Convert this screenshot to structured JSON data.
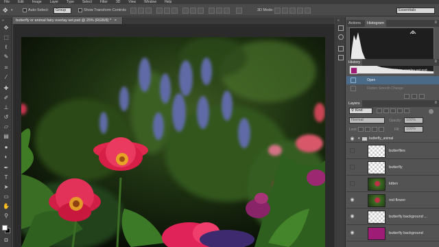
{
  "menu": [
    "File",
    "Edit",
    "Image",
    "Layer",
    "Type",
    "Select",
    "Filter",
    "3D",
    "View",
    "Window",
    "Help"
  ],
  "options": {
    "auto_select_label": "Auto-Select:",
    "auto_select_value": "Group",
    "transform_label": "Show Transform Controls",
    "mode_3d_label": "3D Mode:",
    "workspace": "Essentials"
  },
  "document": {
    "tab_title": "butterfly or animal fairy overlay set.psd @ 25% (RGB/8) *",
    "tab_close": "×"
  },
  "panels": {
    "tabs_top": [
      "Actions",
      "Histogram"
    ],
    "history": {
      "tab": "History",
      "snapshot_label": "butterfly or animal fairy overlay set.psd",
      "items": [
        "Open",
        "Flatten Smooth Change"
      ]
    },
    "layers": {
      "tab": "Layers",
      "kind_label": "Kind",
      "blend_mode": "Normal",
      "opacity_label": "Opacity:",
      "opacity_value": "100%",
      "lock_label": "Lock:",
      "fill_label": "Fill:",
      "fill_value": "100%",
      "group_name": "butterfly_animal",
      "items": [
        {
          "name": "butterflies",
          "thumb": "transparent",
          "visible": false
        },
        {
          "name": "butterfly",
          "thumb": "transparent",
          "visible": false
        },
        {
          "name": "kitten",
          "thumb": "photo",
          "visible": false
        },
        {
          "name": "red flower",
          "thumb": "photo",
          "visible": true
        },
        {
          "name": "butterfly background ...",
          "thumb": "transparent",
          "visible": true
        },
        {
          "name": "butterfly background",
          "thumb": "magenta",
          "visible": true
        }
      ]
    }
  },
  "colors": {
    "accent_magenta": "#9e1b76",
    "panel_bg": "#535353",
    "history_selected": "#4b6a87"
  },
  "icons": [
    "move-tool-icon",
    "marquee-tool-icon",
    "lasso-tool-icon",
    "quick-select-icon",
    "crop-tool-icon",
    "eyedropper-icon",
    "healing-brush-icon",
    "brush-tool-icon",
    "clone-stamp-icon",
    "history-brush-icon",
    "eraser-icon",
    "gradient-icon",
    "blur-icon",
    "dodge-icon",
    "pen-tool-icon",
    "type-tool-icon",
    "path-select-icon",
    "shape-tool-icon",
    "hand-tool-icon",
    "zoom-tool-icon",
    "eye-icon",
    "folder-icon",
    "filter-icon"
  ]
}
